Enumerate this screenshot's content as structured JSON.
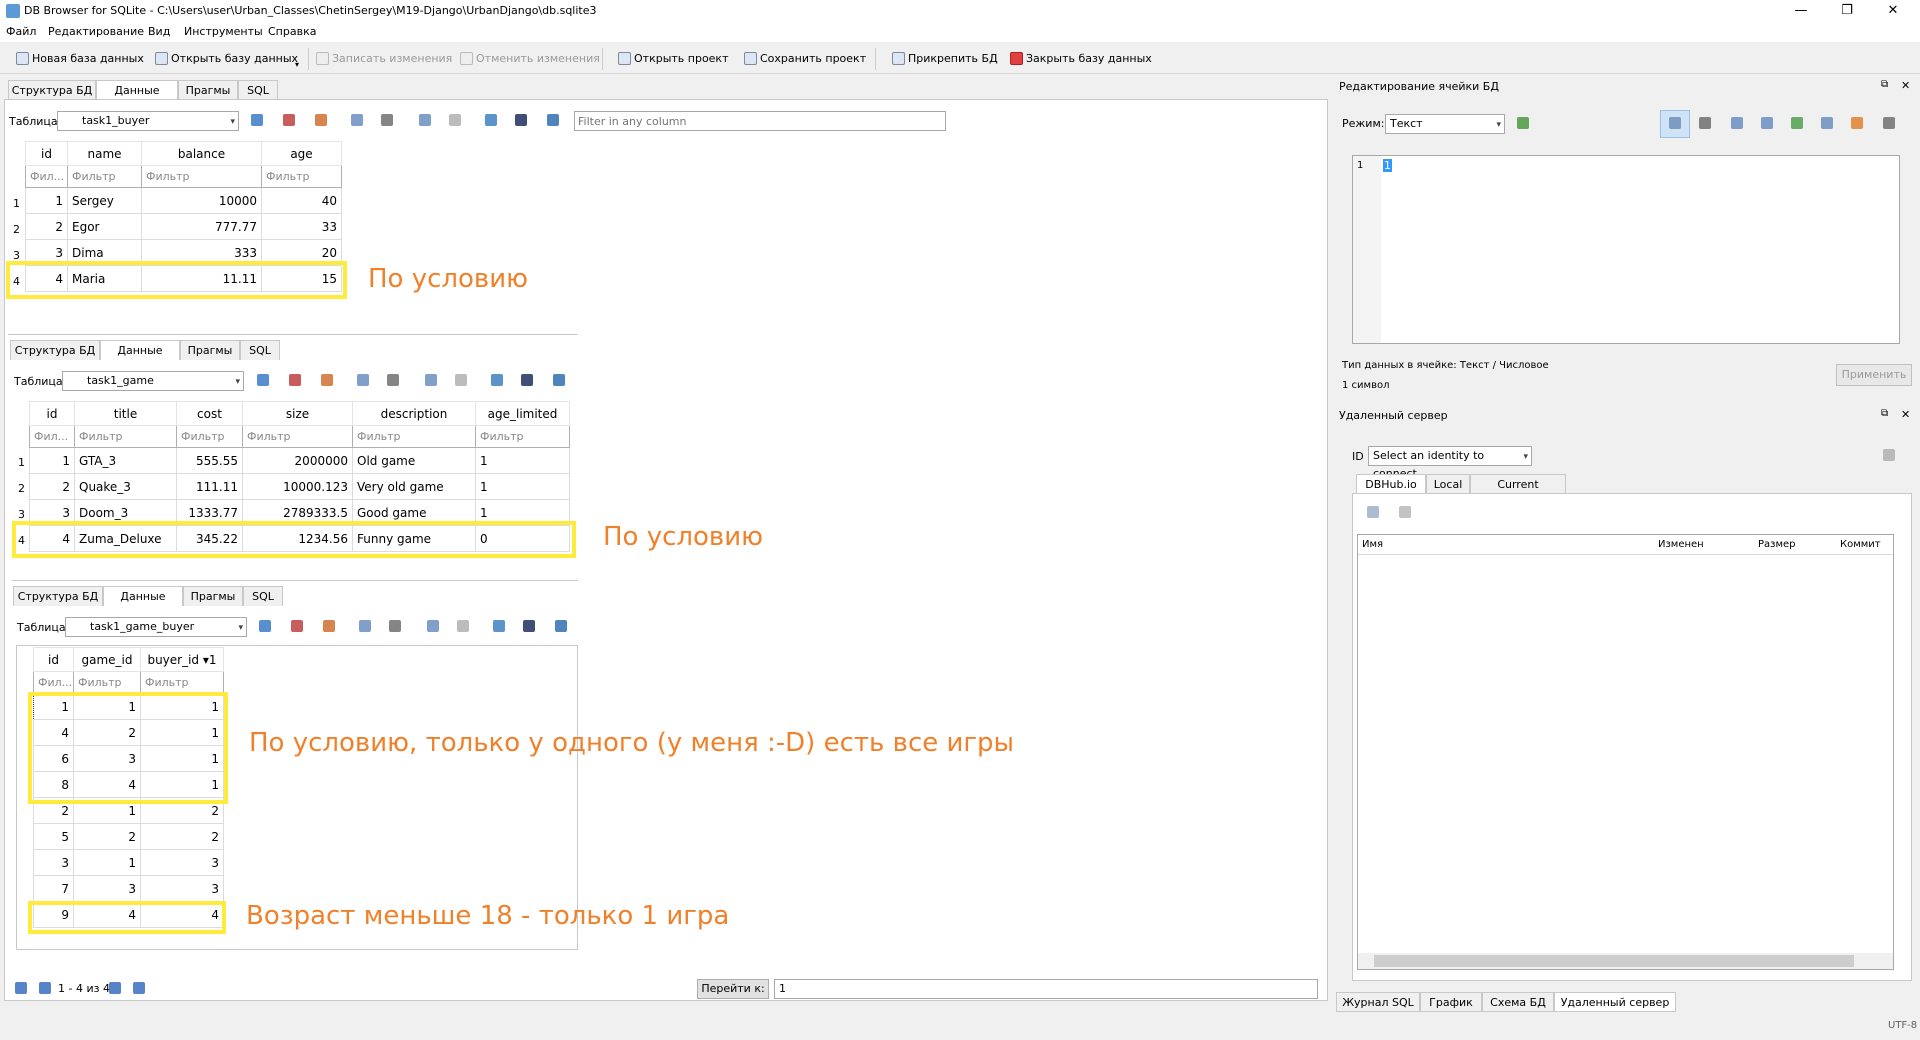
{
  "window": {
    "title": "DB Browser for SQLite - C:\\Users\\user\\Urban_Classes\\ChetinSergey\\M19-Django\\UrbanDjango\\db.sqlite3",
    "minimize": "—",
    "maximize": "❐",
    "close": "✕"
  },
  "menu": [
    "Файл",
    "Редактирование",
    "Вид",
    "Инструменты",
    "Справка"
  ],
  "toolbar": {
    "new_db": "Новая база данных",
    "open_db": "Открыть базу данных",
    "write_changes": "Записать изменения",
    "revert_changes": "Отменить изменения",
    "open_project": "Открыть проект",
    "save_project": "Сохранить проект",
    "attach_db": "Прикрепить БД",
    "close_db": "Закрыть базу данных"
  },
  "tabs": [
    "Структура БД",
    "Данные",
    "Прагмы",
    "SQL"
  ],
  "table_label": "Таблица:",
  "filter_placeholder": "Filter in any column",
  "filter_short": "Фил...",
  "filter": "Фильтр",
  "buyer": {
    "table": "task1_buyer",
    "columns": [
      "id",
      "name",
      "balance",
      "age"
    ],
    "rows": [
      [
        "1",
        "Sergey",
        "10000",
        "40"
      ],
      [
        "2",
        "Egor",
        "777.77",
        "33"
      ],
      [
        "3",
        "Dima",
        "333",
        "20"
      ],
      [
        "4",
        "Maria",
        "11.11",
        "15"
      ]
    ]
  },
  "game": {
    "table": "task1_game",
    "columns": [
      "id",
      "title",
      "cost",
      "size",
      "description",
      "age_limited"
    ],
    "rows": [
      [
        "1",
        "GTA_3",
        "555.55",
        "2000000",
        "Old game",
        "1"
      ],
      [
        "2",
        "Quake_3",
        "111.11",
        "10000.123",
        "Very old game",
        "1"
      ],
      [
        "3",
        "Doom_3",
        "1333.77",
        "2789333.5",
        "Good game",
        "1"
      ],
      [
        "4",
        "Zuma_Deluxe",
        "345.22",
        "1234.56",
        "Funny game",
        "0"
      ]
    ]
  },
  "game_buyer": {
    "table": "task1_game_buyer",
    "columns": [
      "id",
      "game_id",
      "buyer_id ▾1"
    ],
    "rows": [
      [
        "1",
        "1",
        "1"
      ],
      [
        "4",
        "2",
        "1"
      ],
      [
        "6",
        "3",
        "1"
      ],
      [
        "8",
        "4",
        "1"
      ],
      [
        "2",
        "1",
        "2"
      ],
      [
        "5",
        "2",
        "2"
      ],
      [
        "3",
        "1",
        "3"
      ],
      [
        "7",
        "3",
        "3"
      ],
      [
        "9",
        "4",
        "4"
      ]
    ]
  },
  "annotations": {
    "a1": "По условию",
    "a2": "По условию",
    "a3": "По условию, только у одного (у меня :-D) есть все игры",
    "a4": "Возраст меньше 18 - только 1 игра"
  },
  "nav": {
    "records": "1 - 4 из 4",
    "goto_label": "Перейти к:",
    "goto_value": "1"
  },
  "edit_cell": {
    "title": "Редактирование ячейки БД",
    "mode_label": "Режим:",
    "mode_value": "Текст",
    "line_no": "1",
    "value": "1",
    "type_info": "Тип данных в ячейке: Текст / Числовое",
    "size_info": "1 символ",
    "apply": "Применить"
  },
  "remote": {
    "title": "Удаленный сервер",
    "id_label": "ID",
    "identity": "Select an identity to connect",
    "tabs": [
      "DBHub.io",
      "Local",
      "Current Database"
    ],
    "columns": [
      "Имя",
      "Изменен",
      "Размер",
      "Коммит"
    ]
  },
  "bottom_tabs": [
    "Журнал SQL",
    "График",
    "Схема БД",
    "Удаленный сервер"
  ],
  "status": "UTF-8"
}
